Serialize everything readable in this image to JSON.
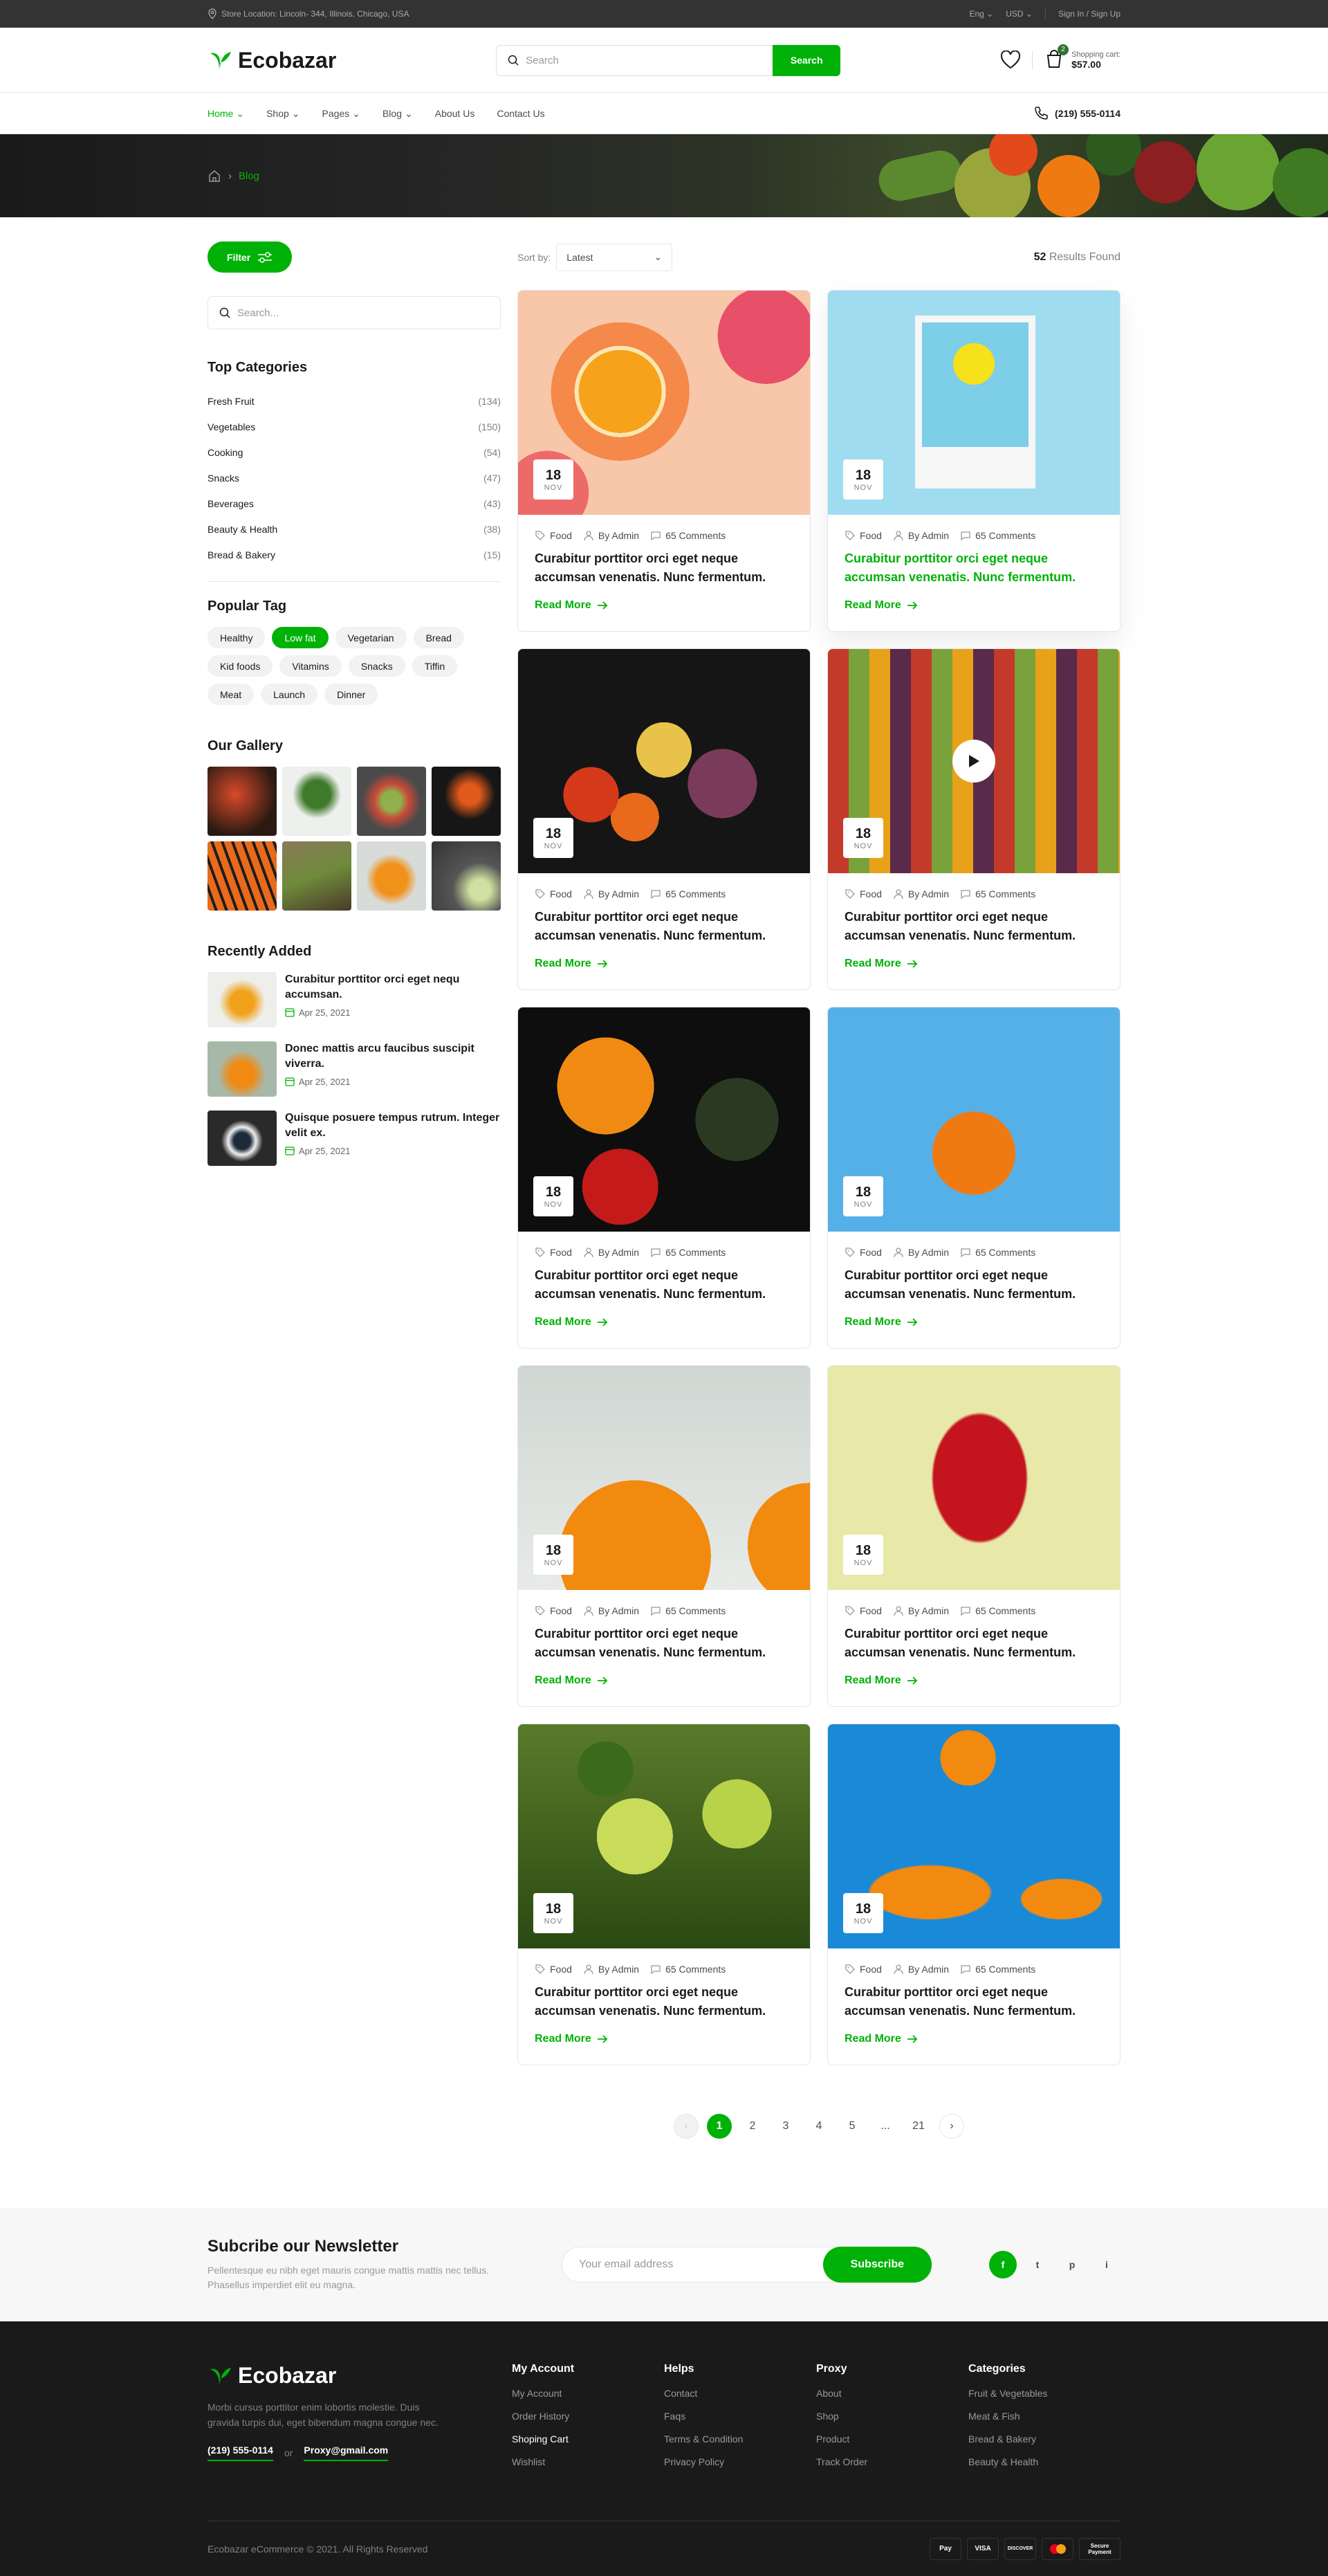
{
  "topbar": {
    "location": "Store Location: Lincoln- 344, Illinois, Chicago, USA",
    "lang": "Eng",
    "currency": "USD",
    "auth": "Sign In / Sign Up"
  },
  "header": {
    "brand": "Ecobazar",
    "search_placeholder": "Search",
    "search_button": "Search",
    "cart_label": "Shopping cart:",
    "cart_total": "$57.00",
    "cart_count": "2"
  },
  "nav": {
    "items": [
      "Home",
      "Shop",
      "Pages",
      "Blog",
      "About Us",
      "Contact Us"
    ],
    "phone": "(219) 555-0114"
  },
  "breadcrumb": {
    "current": "Blog"
  },
  "sidebar": {
    "filter_label": "Filter",
    "search_placeholder": "Search...",
    "categories_title": "Top Categories",
    "categories": [
      {
        "name": "Fresh Fruit",
        "count": "(134)"
      },
      {
        "name": "Vegetables",
        "count": "(150)"
      },
      {
        "name": "Cooking",
        "count": "(54)"
      },
      {
        "name": "Snacks",
        "count": "(47)"
      },
      {
        "name": "Beverages",
        "count": "(43)"
      },
      {
        "name": "Beauty & Health",
        "count": "(38)"
      },
      {
        "name": "Bread & Bakery",
        "count": "(15)"
      }
    ],
    "tags_title": "Popular Tag",
    "tags": [
      "Healthy",
      "Low fat",
      "Vegetarian",
      "Bread",
      "Kid foods",
      "Vitamins",
      "Snacks",
      "Tiffin",
      "Meat",
      "Launch",
      "Dinner"
    ],
    "active_tag": "Low fat",
    "gallery_title": "Our Gallery",
    "recent_title": "Recently Added",
    "recent": [
      {
        "title": "Curabitur porttitor orci eget nequ accumsan.",
        "date": "Apr 25, 2021"
      },
      {
        "title": "Donec mattis arcu faucibus suscipit viverra.",
        "date": "Apr 25, 2021"
      },
      {
        "title": "Quisque posuere tempus rutrum. Integer velit ex.",
        "date": "Apr 25, 2021"
      }
    ]
  },
  "toolbar": {
    "sort_label": "Sort by:",
    "sort_value": "Latest",
    "results_count": "52",
    "results_label": "Results Found"
  },
  "posts": [
    {
      "day": "18",
      "month": "NOV",
      "tag": "Food",
      "author": "By Admin",
      "comments": "65 Comments",
      "title": "Curabitur porttitor orci eget neque accumsan venenatis. Nunc fermentum.",
      "read": "Read More",
      "highlight": false,
      "bg": "grapefruit"
    },
    {
      "day": "18",
      "month": "NOV",
      "tag": "Food",
      "author": "By Admin",
      "comments": "65 Comments",
      "title": "Curabitur porttitor orci eget neque accumsan venenatis. Nunc fermentum.",
      "read": "Read More",
      "highlight": true,
      "bg": "lemon"
    },
    {
      "day": "18",
      "month": "NOV",
      "tag": "Food",
      "author": "By Admin",
      "comments": "65 Comments",
      "title": "Curabitur porttitor orci eget neque accumsan venenatis. Nunc fermentum.",
      "read": "Read More",
      "highlight": false,
      "bg": "veggies"
    },
    {
      "day": "18",
      "month": "NOV",
      "tag": "Food",
      "author": "By Admin",
      "comments": "65 Comments",
      "title": "Curabitur porttitor orci eget neque accumsan venenatis. Nunc fermentum.",
      "read": "Read More",
      "highlight": false,
      "bg": "market",
      "video": true
    },
    {
      "day": "18",
      "month": "NOV",
      "tag": "Food",
      "author": "By Admin",
      "comments": "65 Comments",
      "title": "Curabitur porttitor orci eget neque accumsan venenatis. Nunc fermentum.",
      "read": "Read More",
      "highlight": false,
      "bg": "peppers"
    },
    {
      "day": "18",
      "month": "NOV",
      "tag": "Food",
      "author": "By Admin",
      "comments": "65 Comments",
      "title": "Curabitur porttitor orci eget neque accumsan venenatis. Nunc fermentum.",
      "read": "Read More",
      "highlight": false,
      "bg": "tangerine"
    },
    {
      "day": "18",
      "month": "NOV",
      "tag": "Food",
      "author": "By Admin",
      "comments": "65 Comments",
      "title": "Curabitur porttitor orci eget neque accumsan venenatis. Nunc fermentum.",
      "read": "Read More",
      "highlight": false,
      "bg": "oranges"
    },
    {
      "day": "18",
      "month": "NOV",
      "tag": "Food",
      "author": "By Admin",
      "comments": "65 Comments",
      "title": "Curabitur porttitor orci eget neque accumsan venenatis. Nunc fermentum.",
      "read": "Read More",
      "highlight": false,
      "bg": "strawberry"
    },
    {
      "day": "18",
      "month": "NOV",
      "tag": "Food",
      "author": "By Admin",
      "comments": "65 Comments",
      "title": "Curabitur porttitor orci eget neque accumsan venenatis. Nunc fermentum.",
      "read": "Read More",
      "highlight": false,
      "bg": "limes"
    },
    {
      "day": "18",
      "month": "NOV",
      "tag": "Food",
      "author": "By Admin",
      "comments": "65 Comments",
      "title": "Curabitur porttitor orci eget neque accumsan venenatis. Nunc fermentum.",
      "read": "Read More",
      "highlight": false,
      "bg": "orangeslices"
    }
  ],
  "pagination": {
    "pages": [
      "1",
      "2",
      "3",
      "4",
      "5",
      "...",
      "21"
    ],
    "current": "1"
  },
  "newsletter": {
    "title": "Subcribe our Newsletter",
    "text": "Pellentesque eu nibh eget mauris congue mattis mattis nec tellus. Phasellus imperdiet elit eu magna.",
    "placeholder": "Your email address",
    "button": "Subscribe",
    "social": [
      "f",
      "t",
      "p",
      "i"
    ]
  },
  "footer": {
    "brand": "Ecobazar",
    "about": "Morbi cursus porttitor enim lobortis molestie. Duis gravida turpis dui, eget bibendum magna congue nec.",
    "phone": "(219) 555-0114",
    "or": "or",
    "email": "Proxy@gmail.com",
    "columns": [
      {
        "title": "My Account",
        "links": [
          "My Account",
          "Order History",
          "Shoping Cart",
          "Wishlist"
        ],
        "highlight": "Shoping Cart"
      },
      {
        "title": "Helps",
        "links": [
          "Contact",
          "Faqs",
          "Terms & Condition",
          "Privacy Policy"
        ]
      },
      {
        "title": "Proxy",
        "links": [
          "About",
          "Shop",
          "Product",
          "Track Order"
        ]
      },
      {
        "title": "Categories",
        "links": [
          "Fruit & Vegetables",
          "Meat & Fish",
          "Bread & Bakery",
          "Beauty & Health"
        ]
      }
    ],
    "copyright": "Ecobazar eCommerce © 2021. All Rights Reserved",
    "payments": [
      "Pay",
      "VISA",
      "DISCOVER",
      "mc",
      "Secure Payment"
    ]
  },
  "colors": {
    "accent": "#00b207",
    "dark": "#1a1a1a"
  }
}
